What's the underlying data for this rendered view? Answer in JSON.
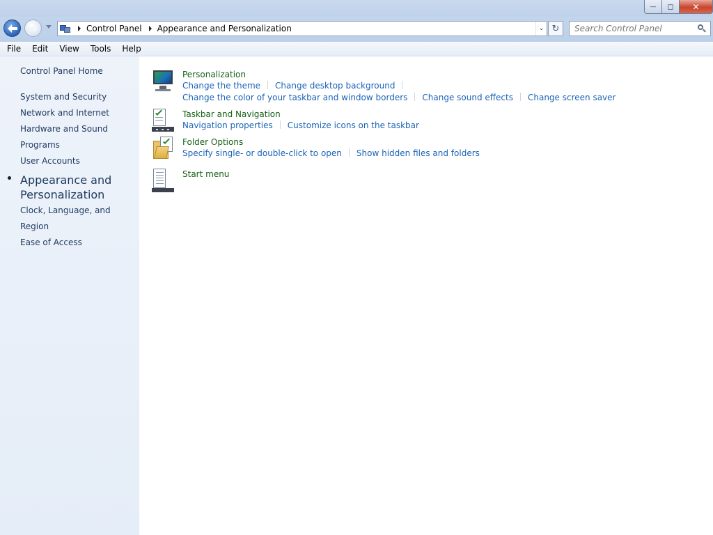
{
  "window": {
    "caption_buttons": {
      "minimize_glyph": "—",
      "maximize_glyph": "◻",
      "close_glyph": "✕"
    }
  },
  "navigation": {
    "back_icon": "back-arrow-icon",
    "forward_icon": "forward-arrow-icon",
    "breadcrumbs": [
      "Control Panel",
      "Appearance and Personalization"
    ],
    "refresh_glyph": "↻",
    "address_dropdown_glyph": "⌄",
    "search": {
      "placeholder": "Search Control Panel",
      "value": ""
    }
  },
  "menu": {
    "items": [
      "File",
      "Edit",
      "View",
      "Tools",
      "Help"
    ]
  },
  "sidebar": {
    "home": "Control Panel Home",
    "items": [
      {
        "label": "System and Security"
      },
      {
        "label": "Network and Internet"
      },
      {
        "label": "Hardware and Sound"
      },
      {
        "label": "Programs"
      },
      {
        "label": "User Accounts"
      }
    ],
    "current": {
      "line1": "Appearance and",
      "line2": "Personalization"
    },
    "items_after": [
      {
        "label": "Clock, Language, and Region"
      },
      {
        "label": "Ease of Access"
      }
    ]
  },
  "categories": [
    {
      "title": "Personalization",
      "icon": "monitor-icon",
      "link_rows": [
        [
          "Change the theme",
          "Change desktop background"
        ],
        [
          "Change the color of your taskbar and window borders",
          "Change sound effects",
          "Change screen saver"
        ]
      ]
    },
    {
      "title": "Taskbar and Navigation",
      "icon": "taskbar-icon",
      "link_rows": [
        [
          "Navigation properties",
          "Customize icons on the taskbar"
        ]
      ]
    },
    {
      "title": "Folder Options",
      "icon": "folder-options-icon",
      "link_rows": [
        [
          "Specify single- or double-click to open",
          "Show hidden files and folders"
        ]
      ]
    },
    {
      "title": "Start menu",
      "icon": "start-menu-icon",
      "link_rows": []
    }
  ],
  "colors": {
    "link": "#1a63b8",
    "category_title": "#166016",
    "sidebar_background": "#e5edf8"
  }
}
